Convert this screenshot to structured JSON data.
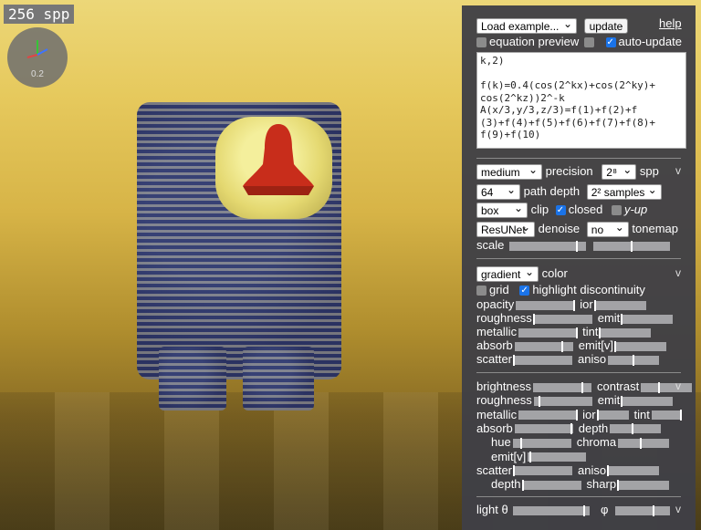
{
  "viewport": {
    "spp_label": "256 spp",
    "gizmo_value": "0.2"
  },
  "toolbar": {
    "example_select": "Load example...",
    "update_label": "update",
    "help_label": "help"
  },
  "toggles": {
    "equation_preview": "equation preview",
    "auto_update": "auto-update"
  },
  "equation_text": "k,2)\n\nf(k)=0.4(cos(2^kx)+cos(2^ky)+\ncos(2^kz))2^-k\nA(x/3,y/3,z/3)=f(1)+f(2)+f\n(3)+f(4)+f(5)+f(6)+f(7)+f(8)+\nf(9)+f(10)",
  "render": {
    "precision_select": "medium",
    "precision_label": "precision",
    "spp_select": "2⁸",
    "spp_label": "spp",
    "path_depth_select": "64",
    "path_depth_label": "path depth",
    "samples_select": "2² samples",
    "clip_select": "box",
    "clip_label": "clip",
    "closed_label": "closed",
    "yup_label": "y-up",
    "denoise_select": "ResUNet",
    "denoise_label": "denoise",
    "tonemap_select": "no",
    "tonemap_label": "tonemap",
    "scale_label": "scale",
    "scale_1_value": 0.88,
    "scale_2_value": 0.5
  },
  "material": {
    "color_select": "gradient",
    "color_label": "color",
    "grid_label": "grid",
    "highlight_label": "highlight discontinuity",
    "rows": [
      {
        "left": "opacity",
        "left_value": 1.0,
        "right": "ior",
        "right_value": 0.0
      },
      {
        "left": "roughness",
        "left_value": 0.0,
        "right": "emit",
        "right_value": 0.0
      },
      {
        "left": "metallic",
        "left_value": 1.0,
        "right": "tint",
        "right_value": 0.0
      },
      {
        "left": "absorb",
        "left_value": 0.82,
        "right": "emit[v]",
        "right_value": 0.0
      },
      {
        "left": "scatter",
        "left_value": 0.0,
        "right": "aniso",
        "right_value": 0.5
      }
    ]
  },
  "lighting": {
    "rows": [
      {
        "left": "brightness",
        "left_value": 0.85,
        "right": "contrast",
        "right_value": 0.35
      },
      {
        "left": "roughness",
        "left_value": 0.1,
        "right": "emit",
        "right_value": 0.0
      },
      {
        "left": "metallic",
        "left_value": 1.0,
        "right": "ior",
        "right_value": 0.0,
        "right2": "tint",
        "right2_value": 1.0
      },
      {
        "left": "absorb",
        "left_value": 0.98,
        "right": "depth",
        "right_value": 0.45
      },
      {
        "left": "hue",
        "left_value": 0.15,
        "right": "chroma",
        "right_value": 0.45,
        "indent": true
      },
      {
        "left": "emit[v]",
        "left_value": 0.05,
        "indent": true
      },
      {
        "left": "scatter",
        "left_value": 0.0,
        "right": "aniso",
        "right_value": 0.0
      },
      {
        "left": "depth",
        "left_value": 0.0,
        "right": "sharp",
        "right_value": 0.0,
        "indent": true
      }
    ],
    "light_label": "light θ",
    "phi_label": "φ",
    "light_theta_value": 0.93,
    "light_phi_value": 0.7
  }
}
